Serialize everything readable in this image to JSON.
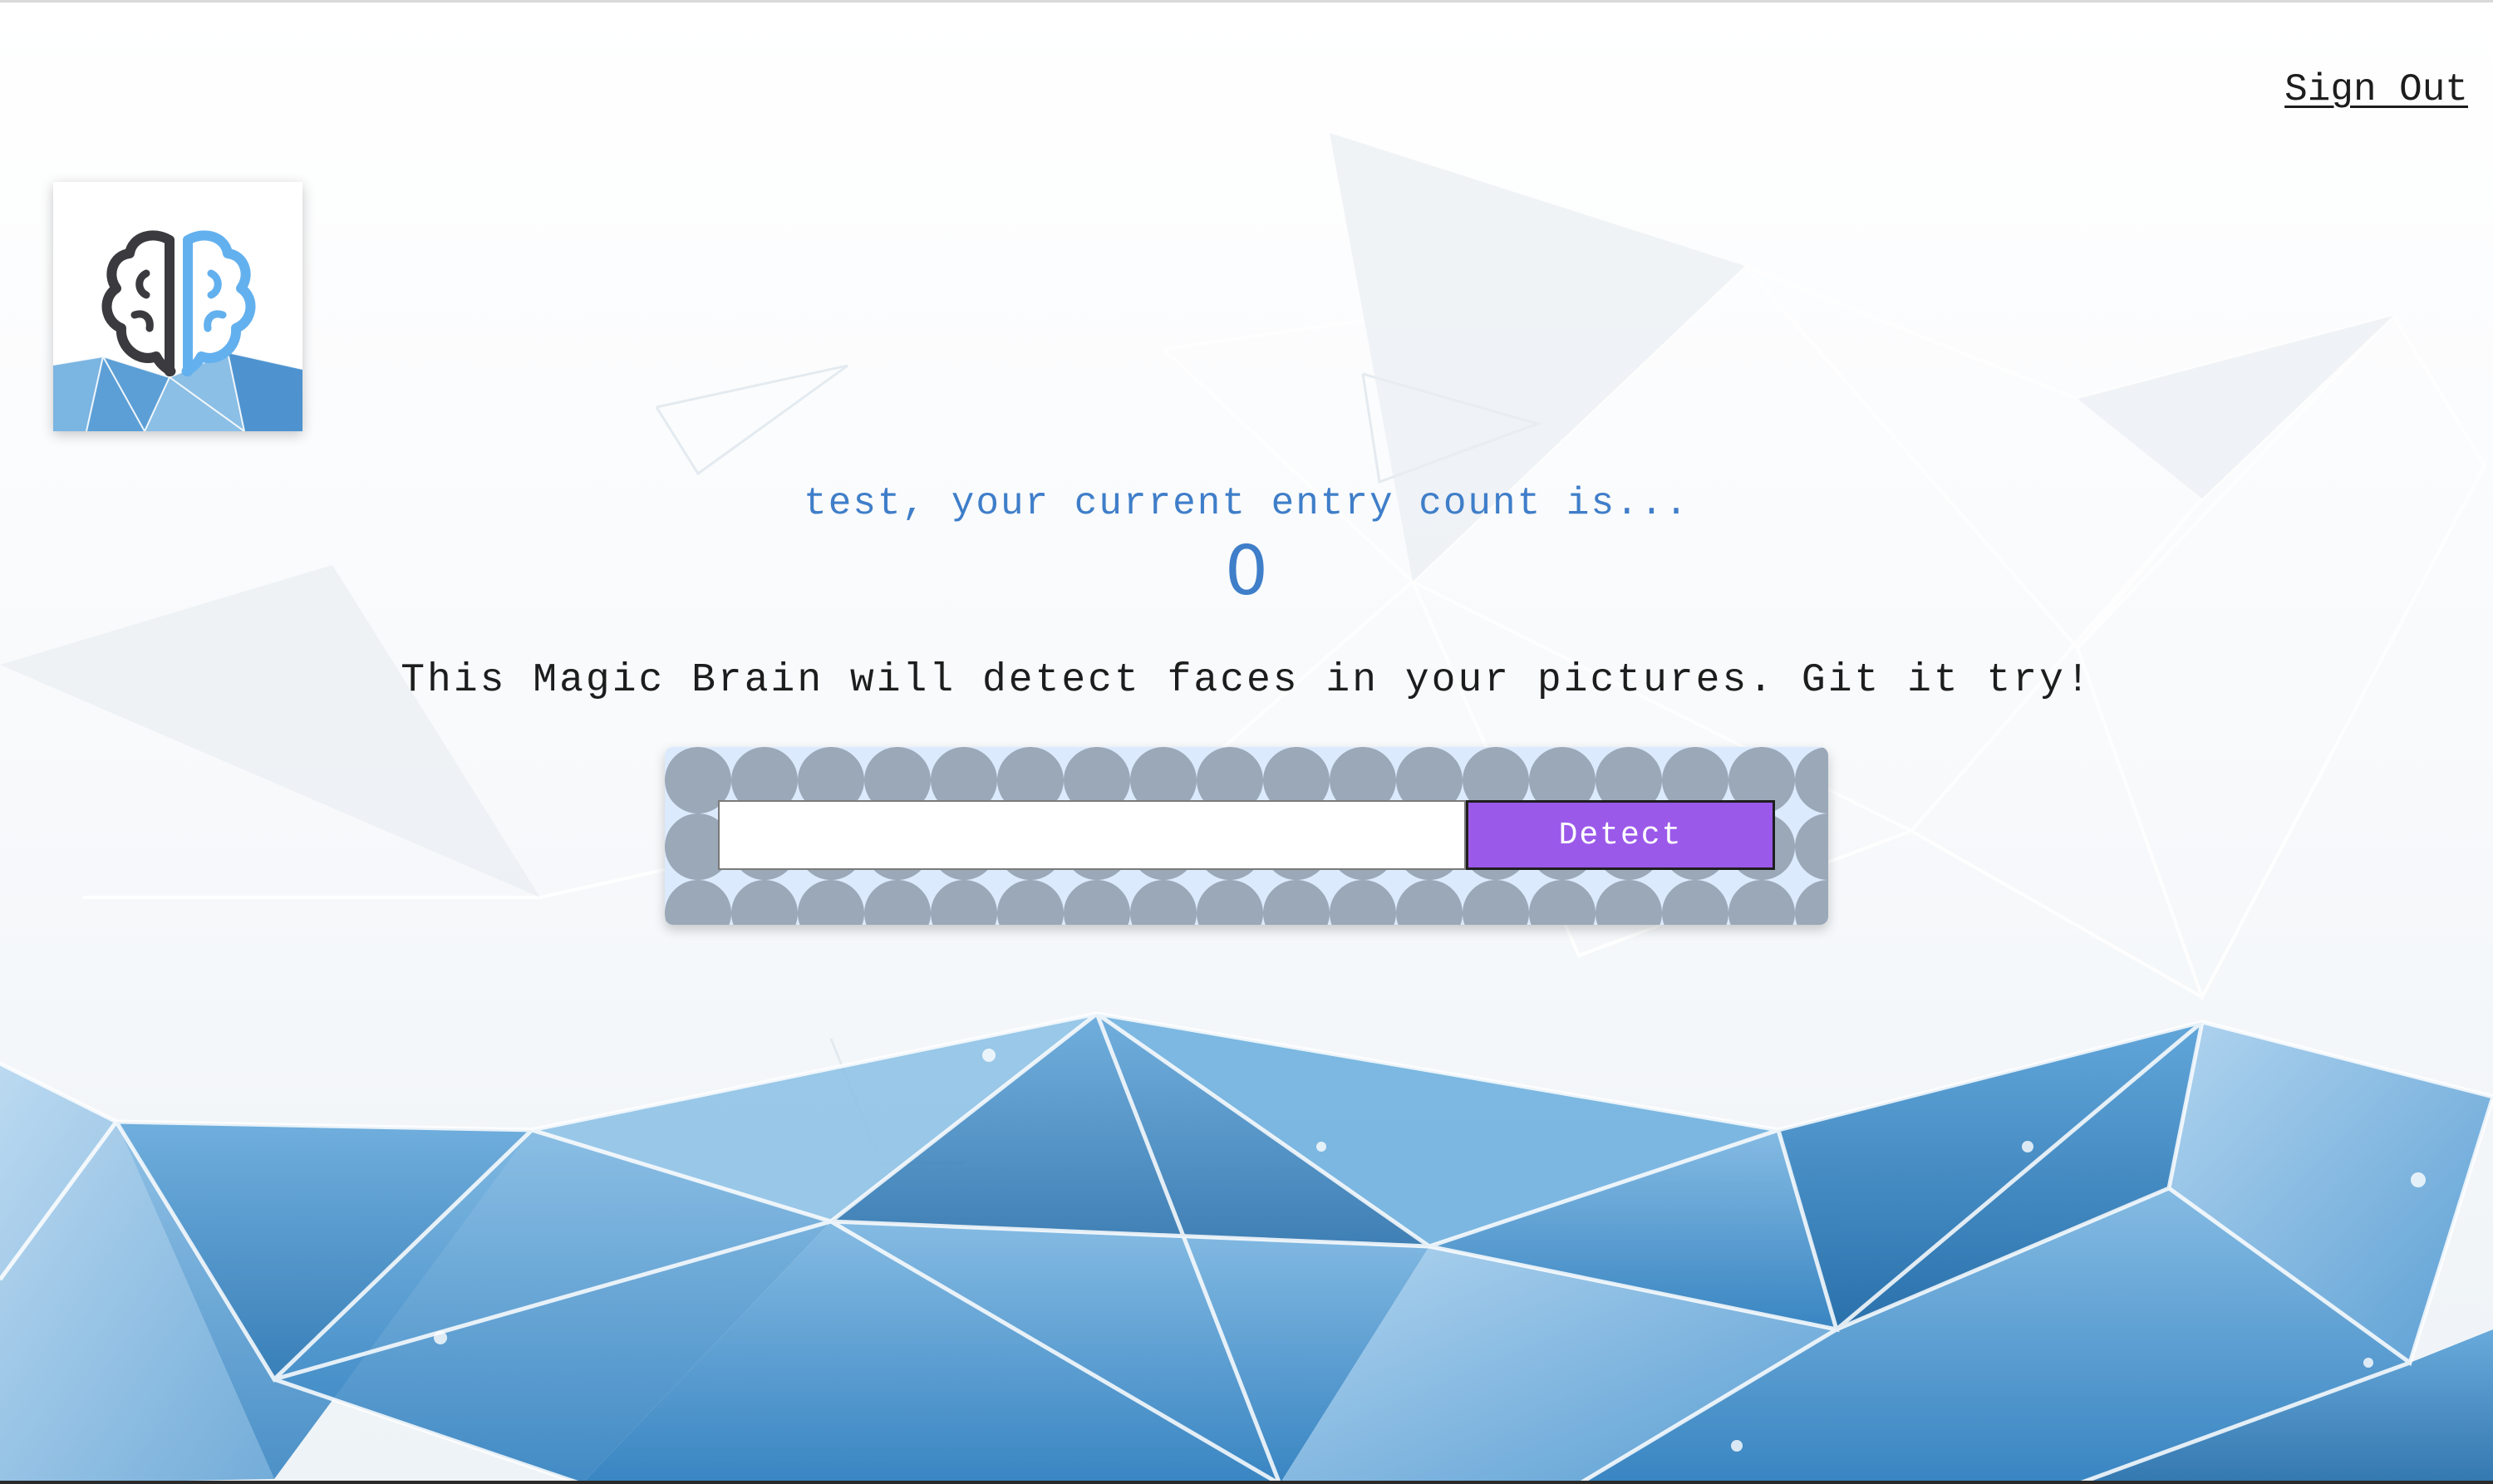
{
  "nav": {
    "sign_out_label": "Sign Out"
  },
  "logo": {
    "icon": "brain-icon"
  },
  "rank": {
    "greeting": "test, your current entry count is...",
    "count": "0"
  },
  "image_link_form": {
    "description": "This Magic Brain will detect faces in your pictures. Git it try!",
    "input_value": "",
    "detect_label": "Detect"
  },
  "colors": {
    "accent_text": "#3f7ec9",
    "button": "#9b59ea",
    "panel_pattern_bg": "#9aa8b8",
    "panel_pattern_circle": "#dbeafc",
    "background_polygons": "#3d8fcc"
  }
}
